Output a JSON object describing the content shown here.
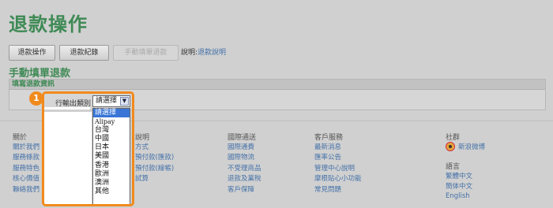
{
  "header": {
    "title": "退款操作"
  },
  "toolbar": {
    "refund_label": "退款操作",
    "records_label": "退款紀錄",
    "manual_label": "手動填單退款",
    "explain_prefix": "說明:",
    "explain_link": "退款說明"
  },
  "section": {
    "title": "手動填單退款",
    "box_header": "填寫退款資訊",
    "row_label": "行輸出類別"
  },
  "select": {
    "selected": "請選擇",
    "arrow": "▼",
    "options": [
      "請選擇",
      "Alipay",
      "台灣",
      "中國",
      "日本",
      "美國",
      "香港",
      "歐洲",
      "澳洲",
      "其他"
    ]
  },
  "annotation": {
    "step": "1",
    "color": "#f18a1d"
  },
  "footer": {
    "about": {
      "title": "關於",
      "links": [
        "關於我們",
        "服務條款",
        "服務特色",
        "核心價值",
        "聯絡我們"
      ]
    },
    "info": {
      "title": "說明",
      "links": [
        "方式",
        "預付款(匯款)",
        "預付款(線帳)",
        "試算"
      ]
    },
    "intl": {
      "title": "國際通送",
      "links": [
        "國際通費",
        "國際物流",
        "不受理商品",
        "退款及業稅",
        "客戶保障"
      ]
    },
    "service": {
      "title": "客戶服務",
      "links": [
        "最新消息",
        "匯率公告",
        "管理中心說明",
        "摩根貼心小功能",
        "常見問題"
      ]
    },
    "social": {
      "title": "社群",
      "weibo": "新浪微博"
    },
    "language": {
      "title": "語言",
      "links": [
        "繁體中文",
        "簡体中文",
        "English"
      ]
    }
  },
  "colors": {
    "accent": "#3f8a55",
    "link": "#4471a8",
    "highlight": "#f18a1d",
    "selected_option": "#3875d7"
  }
}
